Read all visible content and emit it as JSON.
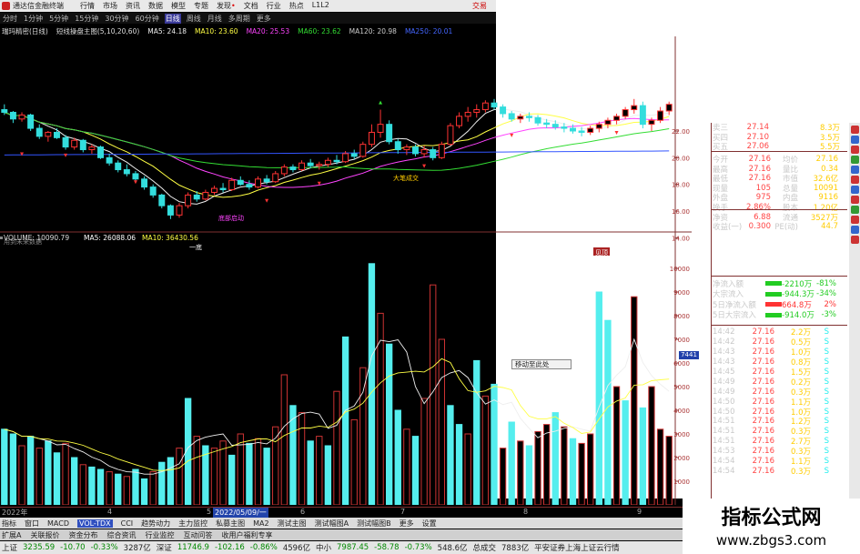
{
  "app": {
    "title": "通达信金融终端",
    "menu": [
      "行情",
      "市场",
      "资讯",
      "数据",
      "模型",
      "专题",
      "发现",
      "文档",
      "行业",
      "热点",
      "L1L2"
    ],
    "trade_label": "交易",
    "accent": "#e03030"
  },
  "period_tabs": [
    "分时",
    "1分钟",
    "5分钟",
    "15分钟",
    "30分钟",
    "60分钟",
    "日线",
    "周线",
    "月线",
    "多周期",
    "更多"
  ],
  "selected_period": "日线",
  "info": {
    "stock": "瑞玛精密(日线)",
    "indicator": "短线操盘主图(5,10,20,60)",
    "ma5": "MA5: 24.18",
    "ma10": "MA10: 23.60",
    "ma20": "MA20: 25.53",
    "ma60": "MA60: 23.62",
    "ma120": "MA120: 20.98",
    "ma250": "MA250: 20.01"
  },
  "price_axis": [
    "22.00",
    "20.00",
    "18.00",
    "16.00",
    "14.00"
  ],
  "chart_labels": {
    "future_note": "用到未来数据",
    "low_mark": "一底",
    "zone_mark": "底部启动",
    "big_deal": "大笔成交",
    "hint": "见顶"
  },
  "volume": {
    "title": "VOLUME: 10090.79",
    "ma5": "MA5: 26088.06",
    "ma10": "MA10: 36430.56",
    "axis": [
      "10000",
      "9000",
      "8000",
      "7000",
      "6000",
      "5000",
      "4000",
      "3000",
      "2000",
      "1000"
    ],
    "current_box": "7441",
    "popup": "移动至此处"
  },
  "date_axis": [
    {
      "label": "2022年",
      "hl": false
    },
    {
      "label": "4",
      "hl": false
    },
    {
      "label": "5",
      "hl": false
    },
    {
      "label": "2022/05/09/一",
      "hl": true
    },
    {
      "label": "6",
      "hl": false
    },
    {
      "label": "7",
      "hl": false
    },
    {
      "label": "8",
      "hl": false
    },
    {
      "label": "9",
      "hl": false
    }
  ],
  "quote": {
    "asks": [
      {
        "label": "卖三",
        "price": "27.14",
        "vol": "8.3万"
      },
      {
        "label": "买四",
        "price": "27.10",
        "vol": "3.5万"
      },
      {
        "label": "买五",
        "price": "27.06",
        "vol": "5.5万"
      }
    ],
    "stats": [
      {
        "l1": "今开",
        "v1": "27.16",
        "l2": "均价",
        "v2": "27.16"
      },
      {
        "l1": "最高",
        "v1": "27.16",
        "l2": "量比",
        "v2": "0.34"
      },
      {
        "l1": "最低",
        "v1": "27.16",
        "l2": "市值",
        "v2": "32.6亿"
      },
      {
        "l1": "现量",
        "v1": "105",
        "l2": "总量",
        "v2": "10091"
      },
      {
        "l1": "外盘",
        "v1": "975",
        "l2": "内盘",
        "v2": "9116"
      },
      {
        "l1": "换手",
        "v1": "2.86%",
        "l2": "股本",
        "v2": "1.20亿"
      },
      {
        "l1": "净资",
        "v1": "6.88",
        "l2": "流通",
        "v2": "3527万"
      },
      {
        "l1": "收益(一)",
        "v1": "0.300",
        "l2": "PE(动)",
        "v2": "44.7"
      }
    ]
  },
  "fund_flow": [
    {
      "label": "净流入额",
      "value": "-2210万",
      "pct": "-81%",
      "bar": "#22cc22",
      "color": "#22cc22"
    },
    {
      "label": "大宗流入",
      "value": "-944.3万",
      "pct": "-34%",
      "bar": "#22cc22",
      "color": "#22cc22"
    },
    {
      "label": "5日净流入额",
      "value": "664.8万",
      "pct": "2%",
      "bar": "#ff3333",
      "color": "#ff3333"
    },
    {
      "label": "5日大宗流入",
      "value": "-914.0万",
      "pct": "-3%",
      "bar": "#22cc22",
      "color": "#22cc22"
    }
  ],
  "ticks": [
    {
      "t": "14:42",
      "p": "27.16",
      "v": "2.2万",
      "s": "S"
    },
    {
      "t": "14:42",
      "p": "27.16",
      "v": "0.5万",
      "s": "S"
    },
    {
      "t": "14:43",
      "p": "27.16",
      "v": "1.0万",
      "s": "S"
    },
    {
      "t": "14:43",
      "p": "27.16",
      "v": "0.8万",
      "s": "S"
    },
    {
      "t": "14:45",
      "p": "27.16",
      "v": "1.5万",
      "s": "S"
    },
    {
      "t": "14:49",
      "p": "27.16",
      "v": "0.2万",
      "s": "S"
    },
    {
      "t": "14:49",
      "p": "27.16",
      "v": "0.3万",
      "s": "S"
    },
    {
      "t": "14:50",
      "p": "27.16",
      "v": "1.1万",
      "s": "S"
    },
    {
      "t": "14:50",
      "p": "27.16",
      "v": "1.0万",
      "s": "S"
    },
    {
      "t": "14:51",
      "p": "27.16",
      "v": "1.2万",
      "s": "S"
    },
    {
      "t": "14:51",
      "p": "27.16",
      "v": "0.3万",
      "s": "S"
    },
    {
      "t": "14:51",
      "p": "27.16",
      "v": "2.7万",
      "s": "S"
    },
    {
      "t": "14:53",
      "p": "27.16",
      "v": "0.3万",
      "s": "S"
    },
    {
      "t": "14:54",
      "p": "27.16",
      "v": "1.1万",
      "s": "S"
    },
    {
      "t": "14:54",
      "p": "27.16",
      "v": "0.3万",
      "s": "S"
    }
  ],
  "indicator_tabs": [
    "指标",
    "窗口",
    "MACD",
    "VOL-TDX",
    "CCI",
    "趋势动力",
    "主力监控",
    "私募主图",
    "MA2",
    "测试主图",
    "测试幅图A",
    "测试幅图B",
    "更多",
    "设置"
  ],
  "selected_indicator": "VOL-TDX",
  "bottom_tabs": [
    "扩展A",
    "关联报价",
    "资金分布",
    "综合资讯",
    "行业监控",
    "互动问答",
    "收用户福利专享"
  ],
  "status": [
    {
      "name": "上证",
      "value": "3235.59",
      "chg": "-10.70",
      "pct": "-0.33%",
      "amt": "3287亿"
    },
    {
      "name": "深证",
      "value": "11746.9",
      "chg": "-102.16",
      "pct": "-0.86%",
      "amt": "4596亿"
    },
    {
      "name": "中小",
      "value": "7987.45",
      "chg": "-58.78",
      "pct": "-0.73%",
      "amt": "548.6亿"
    }
  ],
  "status_total_label": "总成交",
  "status_total": "7883亿",
  "status_broker": "平安证券上海上证云行情",
  "watermark": {
    "title": "指标公式网",
    "url": "www.zbgs3.com"
  },
  "candles": [
    [
      23.6,
      24.0,
      23.2,
      23.4
    ],
    [
      23.4,
      23.5,
      22.6,
      22.9
    ],
    [
      22.9,
      23.4,
      22.7,
      23.2
    ],
    [
      23.2,
      23.3,
      22.0,
      22.2
    ],
    [
      22.2,
      22.5,
      21.4,
      21.6
    ],
    [
      21.6,
      22.0,
      21.2,
      21.9
    ],
    [
      21.9,
      22.2,
      21.4,
      21.5
    ],
    [
      21.5,
      21.7,
      20.6,
      20.8
    ],
    [
      20.8,
      21.5,
      20.6,
      21.3
    ],
    [
      21.3,
      21.4,
      20.4,
      20.6
    ],
    [
      20.6,
      21.0,
      20.3,
      20.8
    ],
    [
      20.8,
      20.9,
      19.9,
      20.0
    ],
    [
      20.0,
      20.3,
      19.4,
      19.6
    ],
    [
      19.6,
      19.8,
      18.9,
      19.1
    ],
    [
      19.1,
      19.5,
      18.6,
      18.8
    ],
    [
      18.8,
      19.0,
      18.2,
      18.4
    ],
    [
      18.4,
      18.6,
      17.6,
      17.8
    ],
    [
      17.8,
      18.0,
      17.0,
      17.2
    ],
    [
      17.2,
      17.3,
      16.2,
      16.4
    ],
    [
      16.4,
      16.5,
      15.4,
      15.7
    ],
    [
      15.7,
      16.6,
      15.5,
      16.4
    ],
    [
      16.4,
      17.4,
      16.2,
      17.2
    ],
    [
      17.2,
      17.5,
      16.7,
      16.9
    ],
    [
      16.9,
      17.6,
      16.8,
      17.4
    ],
    [
      17.4,
      17.9,
      17.2,
      17.7
    ],
    [
      17.7,
      18.1,
      17.4,
      17.6
    ],
    [
      17.6,
      18.5,
      17.5,
      18.3
    ],
    [
      18.3,
      18.6,
      17.9,
      18.0
    ],
    [
      18.0,
      18.3,
      17.6,
      17.8
    ],
    [
      17.8,
      18.6,
      17.7,
      18.4
    ],
    [
      18.4,
      18.7,
      18.0,
      18.2
    ],
    [
      18.2,
      19.0,
      18.1,
      18.8
    ],
    [
      18.8,
      19.5,
      18.6,
      19.3
    ],
    [
      19.3,
      19.5,
      18.9,
      19.1
    ],
    [
      19.1,
      19.8,
      19.0,
      19.6
    ],
    [
      19.6,
      19.9,
      19.2,
      19.4
    ],
    [
      19.4,
      19.7,
      19.1,
      19.5
    ],
    [
      19.5,
      20.0,
      19.3,
      19.8
    ],
    [
      19.8,
      20.2,
      19.5,
      19.7
    ],
    [
      19.7,
      20.5,
      19.6,
      20.3
    ],
    [
      20.3,
      20.6,
      19.9,
      20.1
    ],
    [
      20.1,
      21.2,
      20.0,
      21.0
    ],
    [
      21.0,
      22.5,
      20.8,
      21.9
    ],
    [
      21.9,
      23.6,
      21.5,
      22.5
    ],
    [
      22.5,
      22.8,
      21.0,
      21.2
    ],
    [
      21.2,
      21.4,
      20.3,
      20.6
    ],
    [
      20.6,
      21.0,
      20.2,
      20.8
    ],
    [
      20.8,
      21.0,
      20.1,
      20.3
    ],
    [
      20.3,
      20.9,
      20.0,
      20.6
    ],
    [
      20.6,
      20.8,
      19.8,
      20.0
    ],
    [
      20.0,
      21.2,
      19.9,
      21.0
    ],
    [
      21.0,
      22.6,
      20.9,
      22.4
    ],
    [
      22.4,
      23.4,
      22.2,
      23.1
    ],
    [
      23.1,
      23.8,
      22.7,
      23.4
    ],
    [
      23.4,
      24.0,
      23.0,
      23.6
    ],
    [
      23.6,
      24.3,
      23.4,
      24.1
    ],
    [
      24.1,
      24.4,
      23.6,
      23.8
    ],
    [
      23.8,
      24.0,
      23.0,
      23.3
    ],
    [
      23.3,
      23.5,
      22.7,
      22.9
    ],
    [
      22.9,
      23.3,
      22.6,
      23.1
    ],
    [
      23.1,
      23.4,
      22.7,
      23.0
    ],
    [
      23.0,
      23.2,
      22.4,
      22.6
    ],
    [
      22.6,
      22.9,
      22.2,
      22.5
    ],
    [
      22.5,
      22.8,
      22.1,
      22.3
    ],
    [
      22.3,
      22.6,
      21.9,
      22.2
    ],
    [
      22.2,
      22.5,
      21.8,
      22.0
    ],
    [
      22.0,
      22.3,
      21.6,
      21.9
    ],
    [
      21.9,
      22.4,
      21.7,
      22.2
    ],
    [
      22.2,
      22.7,
      21.9,
      22.5
    ],
    [
      22.5,
      23.0,
      22.2,
      22.8
    ],
    [
      22.8,
      23.3,
      22.5,
      23.1
    ],
    [
      23.1,
      23.8,
      22.9,
      23.6
    ],
    [
      23.6,
      24.4,
      23.3,
      23.9
    ],
    [
      23.9,
      24.2,
      22.2,
      22.5
    ],
    [
      22.5,
      23.0,
      22.0,
      22.8
    ],
    [
      22.8,
      23.8,
      22.6,
      23.5
    ],
    [
      23.5,
      24.2,
      23.2,
      24.0
    ]
  ],
  "volumes": [
    [
      3200,
      "c"
    ],
    [
      3000,
      "c"
    ],
    [
      2500,
      "r"
    ],
    [
      2900,
      "c"
    ],
    [
      2400,
      "r"
    ],
    [
      2700,
      "c"
    ],
    [
      2200,
      "c"
    ],
    [
      2600,
      "r"
    ],
    [
      2000,
      "c"
    ],
    [
      1700,
      "r"
    ],
    [
      1600,
      "c"
    ],
    [
      1500,
      "c"
    ],
    [
      1400,
      "r"
    ],
    [
      1300,
      "c"
    ],
    [
      1200,
      "r"
    ],
    [
      1500,
      "c"
    ],
    [
      1100,
      "c"
    ],
    [
      1400,
      "r"
    ],
    [
      1800,
      "c"
    ],
    [
      2000,
      "c"
    ],
    [
      2400,
      "r"
    ],
    [
      4500,
      "c"
    ],
    [
      2900,
      "r"
    ],
    [
      2500,
      "c"
    ],
    [
      2400,
      "r"
    ],
    [
      2700,
      "r"
    ],
    [
      2100,
      "c"
    ],
    [
      3000,
      "r"
    ],
    [
      2600,
      "c"
    ],
    [
      2800,
      "r"
    ],
    [
      2400,
      "c"
    ],
    [
      3300,
      "r"
    ],
    [
      5500,
      "r"
    ],
    [
      4200,
      "c"
    ],
    [
      3900,
      "r"
    ],
    [
      2700,
      "c"
    ],
    [
      2900,
      "r"
    ],
    [
      2500,
      "c"
    ],
    [
      4800,
      "r"
    ],
    [
      7100,
      "c"
    ],
    [
      3600,
      "r"
    ],
    [
      5800,
      "r"
    ],
    [
      10200,
      "c"
    ],
    [
      8100,
      "r"
    ],
    [
      6800,
      "c"
    ],
    [
      4000,
      "c"
    ],
    [
      3200,
      "r"
    ],
    [
      2900,
      "c"
    ],
    [
      4500,
      "r"
    ],
    [
      9300,
      "r"
    ],
    [
      7000,
      "r"
    ],
    [
      4200,
      "c"
    ],
    [
      3400,
      "c"
    ],
    [
      3000,
      "r"
    ],
    [
      6100,
      "c"
    ],
    [
      4600,
      "r"
    ],
    [
      5100,
      "c"
    ],
    [
      2400,
      "r"
    ],
    [
      3500,
      "c"
    ],
    [
      2700,
      "r"
    ],
    [
      2500,
      "c"
    ],
    [
      3100,
      "r"
    ],
    [
      3400,
      "r"
    ],
    [
      3900,
      "c"
    ],
    [
      3300,
      "r"
    ],
    [
      2800,
      "c"
    ],
    [
      2600,
      "r"
    ],
    [
      3000,
      "r"
    ],
    [
      9000,
      "c"
    ],
    [
      7800,
      "c"
    ],
    [
      5000,
      "r"
    ],
    [
      4400,
      "c"
    ],
    [
      8800,
      "r"
    ],
    [
      4100,
      "c"
    ],
    [
      5000,
      "r"
    ],
    [
      3200,
      "r"
    ],
    [
      2900,
      "r"
    ]
  ]
}
